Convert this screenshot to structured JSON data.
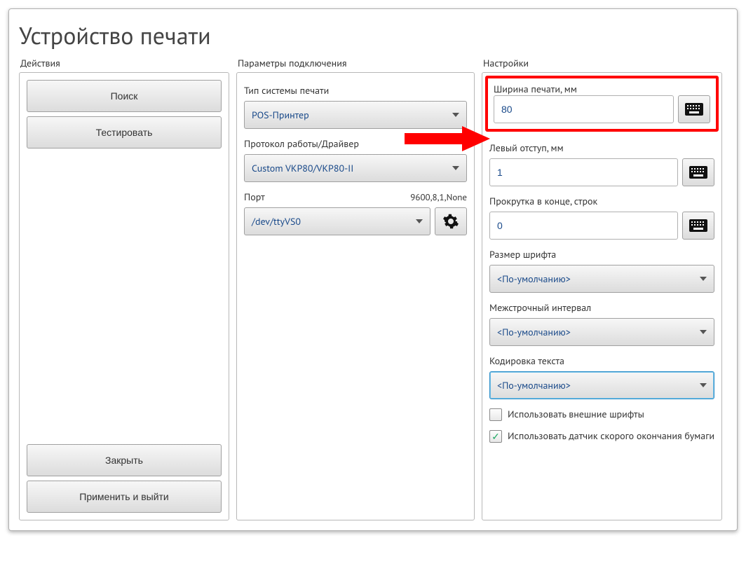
{
  "title": "Устройство печати",
  "columns": {
    "actions": {
      "title": "Действия",
      "buttons": {
        "search": "Поиск",
        "test": "Тестировать",
        "close": "Закрыть",
        "apply_exit": "Применить и выйти"
      }
    },
    "params": {
      "title": "Параметры подключения",
      "print_system_label": "Тип системы печати",
      "print_system_value": "POS-Принтер",
      "protocol_label": "Протокол работы/Драйвер",
      "protocol_value": "Custom VKP80/VKP80-II",
      "port_label": "Порт",
      "port_params": "9600,8,1,None",
      "port_value": "/dev/ttyVS0"
    },
    "settings": {
      "title": "Настройки",
      "print_width_label": "Ширина печати, мм",
      "print_width_value": "80",
      "left_margin_label": "Левый отступ, мм",
      "left_margin_value": "1",
      "scroll_end_label": "Прокрутка в конце, строк",
      "scroll_end_value": "0",
      "font_size_label": "Размер шрифта",
      "font_size_value": "<По-умолчанию>",
      "line_spacing_label": "Межстрочный интервал",
      "line_spacing_value": "<По-умолчанию>",
      "encoding_label": "Кодировка текста",
      "encoding_value": "<По-умолчанию>",
      "use_external_fonts": "Использовать внешние шрифты",
      "use_external_fonts_checked": false,
      "use_paper_sensor": "Использовать датчик скорого окончания бумаги",
      "use_paper_sensor_checked": true
    }
  }
}
